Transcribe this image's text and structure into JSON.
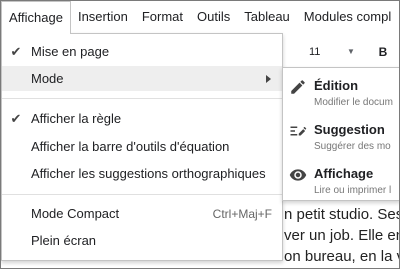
{
  "menubar": {
    "items": [
      {
        "label": "Affichage"
      },
      {
        "label": "Insertion"
      },
      {
        "label": "Format"
      },
      {
        "label": "Outils"
      },
      {
        "label": "Tableau"
      },
      {
        "label": "Modules compl"
      }
    ]
  },
  "toolbar": {
    "font_size": "11",
    "bold_label": "B"
  },
  "document": {
    "lines": [
      "n petit studio. Ses",
      "ver un job. Elle ent",
      "on bureau, en la v"
    ]
  },
  "menu": {
    "items": [
      {
        "label": "Mise en page",
        "checked": true
      },
      {
        "label": "Mode",
        "submenu": true
      },
      {
        "label": "Afficher la règle",
        "checked": true
      },
      {
        "label": "Afficher la barre d'outils d'équation"
      },
      {
        "label": "Afficher les suggestions orthographiques"
      },
      {
        "label": "Mode Compact",
        "shortcut": "Ctrl+Maj+F"
      },
      {
        "label": "Plein écran"
      }
    ],
    "check_glyph": "✔"
  },
  "submenu": {
    "items": [
      {
        "title": "Édition",
        "description": "Modifier le docum",
        "icon": "pencil-icon"
      },
      {
        "title": "Suggestion",
        "description": "Suggérer des mo",
        "icon": "suggest-edit-icon"
      },
      {
        "title": "Affichage",
        "description": "Lire ou imprimer l",
        "icon": "eye-icon"
      }
    ]
  }
}
